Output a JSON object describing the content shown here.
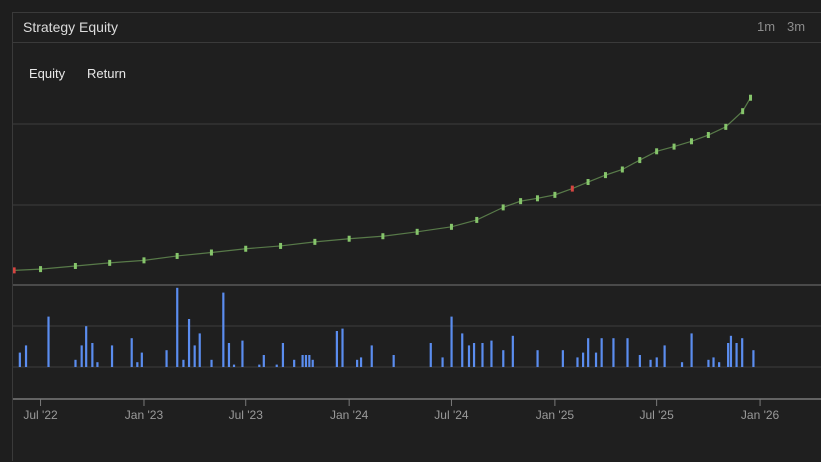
{
  "panel": {
    "title": "Strategy Equity",
    "ranges": [
      "1m",
      "3m"
    ],
    "legend": [
      "Equity",
      "Return"
    ]
  },
  "colors": {
    "up": "#86c56b",
    "down": "#d64541",
    "bar": "#5b8def",
    "grid": "#3d3d3d",
    "axis": "#9a9a9a"
  },
  "chart_data": {
    "type": "line",
    "title": "Strategy Equity",
    "xlabel": "",
    "ylabel": "",
    "x_ticks": [
      "Jul '22",
      "Jan '23",
      "Jul '23",
      "Jan '24",
      "Jul '24",
      "Jan '25",
      "Jul '25",
      "Jan '26"
    ],
    "x_range": [
      "2022-05-13",
      "2026-01-24"
    ],
    "grid": true,
    "legend_position": "top-left",
    "series": [
      {
        "name": "Equity",
        "x": [
          "2022-05-15",
          "2022-07-01",
          "2022-09-01",
          "2022-11-01",
          "2023-01-01",
          "2023-03-01",
          "2023-05-01",
          "2023-07-01",
          "2023-09-01",
          "2023-11-01",
          "2024-01-01",
          "2024-03-01",
          "2024-05-01",
          "2024-07-01",
          "2024-08-15",
          "2024-10-01",
          "2024-11-01",
          "2024-12-01",
          "2025-01-01",
          "2025-02-01",
          "2025-03-01",
          "2025-04-01",
          "2025-05-01",
          "2025-06-01",
          "2025-07-01",
          "2025-08-01",
          "2025-09-01",
          "2025-10-01",
          "2025-11-01",
          "2025-12-01",
          "2025-12-15"
        ],
        "values": [
          0.2,
          0.6,
          1.6,
          2.6,
          3.4,
          4.8,
          5.9,
          7.1,
          8.0,
          9.3,
          10.3,
          11.1,
          12.5,
          14.1,
          16.3,
          20.3,
          22.3,
          23.2,
          24.3,
          26.3,
          28.4,
          30.6,
          32.4,
          35.4,
          38.2,
          39.7,
          41.4,
          43.4,
          46.0,
          51.0,
          55.3
        ]
      },
      {
        "name": "Return",
        "x": [
          "2022-05-25",
          "2022-06-05",
          "2022-07-15",
          "2022-09-01",
          "2022-09-12",
          "2022-09-20",
          "2022-10-01",
          "2022-10-10",
          "2022-11-05",
          "2022-12-10",
          "2022-12-20",
          "2022-12-28",
          "2023-02-10",
          "2023-03-01",
          "2023-03-12",
          "2023-03-22",
          "2023-04-01",
          "2023-04-10",
          "2023-05-01",
          "2023-05-22",
          "2023-06-01",
          "2023-06-10",
          "2023-06-25",
          "2023-07-25",
          "2023-08-02",
          "2023-08-25",
          "2023-09-05",
          "2023-09-25",
          "2023-10-10",
          "2023-10-16",
          "2023-10-22",
          "2023-10-28",
          "2023-12-10",
          "2023-12-20",
          "2024-01-15",
          "2024-01-22",
          "2024-02-10",
          "2024-03-20",
          "2024-05-25",
          "2024-06-15",
          "2024-07-01",
          "2024-07-20",
          "2024-08-01",
          "2024-08-10",
          "2024-08-25",
          "2024-09-10",
          "2024-10-01",
          "2024-10-18",
          "2024-12-01",
          "2025-01-15",
          "2025-02-10",
          "2025-02-20",
          "2025-03-01",
          "2025-03-15",
          "2025-03-25",
          "2025-04-15",
          "2025-05-10",
          "2025-06-01",
          "2025-06-20",
          "2025-07-01",
          "2025-07-15",
          "2025-08-15",
          "2025-09-01",
          "2025-10-01",
          "2025-10-10",
          "2025-10-20",
          "2025-11-05",
          "2025-11-10",
          "2025-11-20",
          "2025-11-30",
          "2025-12-20"
        ],
        "values": [
          0.6,
          0.9,
          2.1,
          0.3,
          0.9,
          1.7,
          1.0,
          0.2,
          0.9,
          1.2,
          0.2,
          0.6,
          0.7,
          3.3,
          0.3,
          2.0,
          0.9,
          1.4,
          0.3,
          3.1,
          1.0,
          0.1,
          1.1,
          0.1,
          0.5,
          0.1,
          1.0,
          0.3,
          0.5,
          0.5,
          0.5,
          0.3,
          1.5,
          1.6,
          0.3,
          0.4,
          0.9,
          0.5,
          1.0,
          0.4,
          2.1,
          1.4,
          0.9,
          1.0,
          1.0,
          1.1,
          0.7,
          1.3,
          0.7,
          0.7,
          0.4,
          0.6,
          1.2,
          0.6,
          1.2,
          1.2,
          1.2,
          0.5,
          0.3,
          0.4,
          0.9,
          0.2,
          1.4,
          0.3,
          0.4,
          0.2,
          1.0,
          1.3,
          1.0,
          1.2,
          0.7
        ]
      }
    ]
  }
}
